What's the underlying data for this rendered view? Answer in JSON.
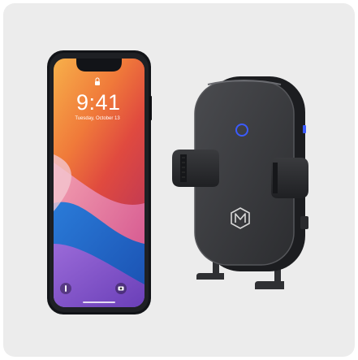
{
  "phone": {
    "time": "9:41",
    "date": "Tuesday, October 13"
  },
  "colors": {
    "background": "#ececec",
    "holder_body": "#2b2c2f",
    "holder_face": "#3a3b3e",
    "indicator": "#3b5bff"
  },
  "icons": [
    "lock-icon",
    "flashlight-icon",
    "camera-icon",
    "m-logo-icon"
  ]
}
